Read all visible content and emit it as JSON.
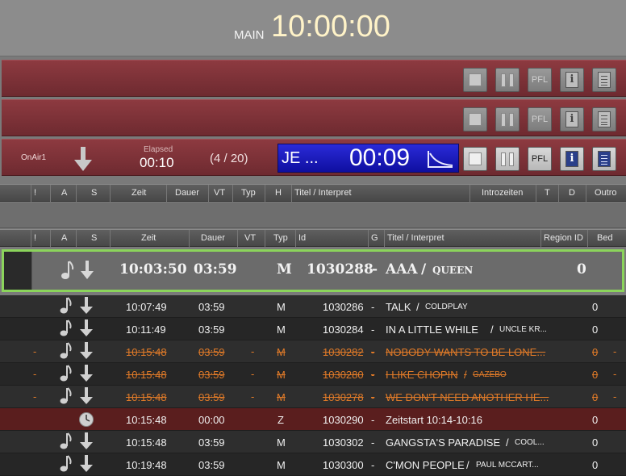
{
  "clock": {
    "label": "MAIN",
    "time": "10:00:00"
  },
  "players": {
    "p1": {
      "pfl": "PFL"
    },
    "p2": {
      "pfl": "PFL"
    },
    "p3": {
      "label": "OnAir1",
      "elapsed_label": "Elapsed",
      "elapsed": "00:10",
      "count": "(4 / 20)",
      "title": "JE ...",
      "remaining": "00:09",
      "pfl": "PFL"
    }
  },
  "header1": [
    "!",
    "A",
    "S",
    "Zeit",
    "Dauer",
    "VT",
    "Typ",
    "H",
    "Titel / Interpret",
    "Introzeiten",
    "T",
    "D",
    "Outro"
  ],
  "header2": [
    "!",
    "A",
    "S",
    "Zeit",
    "Dauer",
    "VT",
    "Typ",
    "Id",
    "G",
    "Titel / Interpret",
    "Region ID",
    "Bed"
  ],
  "current": {
    "zeit": "10:03:50",
    "dauer": "03:59",
    "typ": "M",
    "id": "1030288",
    "dash": "-",
    "title": "AAA",
    "sep": "/",
    "artist": "QUEEN",
    "region": "0"
  },
  "rows": [
    {
      "zeit": "10:07:49",
      "dauer": "03:59",
      "typ": "M",
      "id": "1030286",
      "title": "TALK",
      "artist": "COLDPLAY",
      "region": "0",
      "strike": false
    },
    {
      "zeit": "10:11:49",
      "dauer": "03:59",
      "typ": "M",
      "id": "1030284",
      "title": "IN A LITTLE WHILE",
      "artist": "UNCLE KR...",
      "region": "0",
      "strike": false
    },
    {
      "zeit": "10:15:48",
      "dauer": "03:59",
      "typ": "M",
      "id": "1030282",
      "title": "NOBODY WANTS TO BE LONE...",
      "artist": "",
      "region": "0",
      "strike": true
    },
    {
      "zeit": "10:15:48",
      "dauer": "03:59",
      "typ": "M",
      "id": "1030280",
      "title": "I LIKE CHOPIN",
      "artist": "GAZEBO",
      "region": "0",
      "strike": true
    },
    {
      "zeit": "10:15:48",
      "dauer": "03:59",
      "typ": "M",
      "id": "1030278",
      "title": "WE DON'T NEED ANOTHER HE...",
      "artist": "",
      "region": "0",
      "strike": true
    },
    {
      "zeit": "10:15:48",
      "dauer": "00:00",
      "typ": "Z",
      "id": "1030290",
      "title": "Zeitstart 10:14-10:16",
      "artist": "",
      "region": "0",
      "strike": false,
      "marker": true
    },
    {
      "zeit": "10:15:48",
      "dauer": "03:59",
      "typ": "M",
      "id": "1030302",
      "title": "GANGSTA'S PARADISE",
      "artist": "COOL...",
      "region": "0",
      "strike": false
    },
    {
      "zeit": "10:19:48",
      "dauer": "03:59",
      "typ": "M",
      "id": "1030300",
      "title": "C'MON PEOPLE",
      "artist": "PAUL MCCART...",
      "region": "0",
      "strike": false
    }
  ],
  "dash": "-",
  "sep": "/",
  "colors": {
    "accent_green": "#8bd45b",
    "strike_orange": "#e07a28",
    "player_red": "#7d3238",
    "remaining_blue": "#1a1ac0"
  }
}
